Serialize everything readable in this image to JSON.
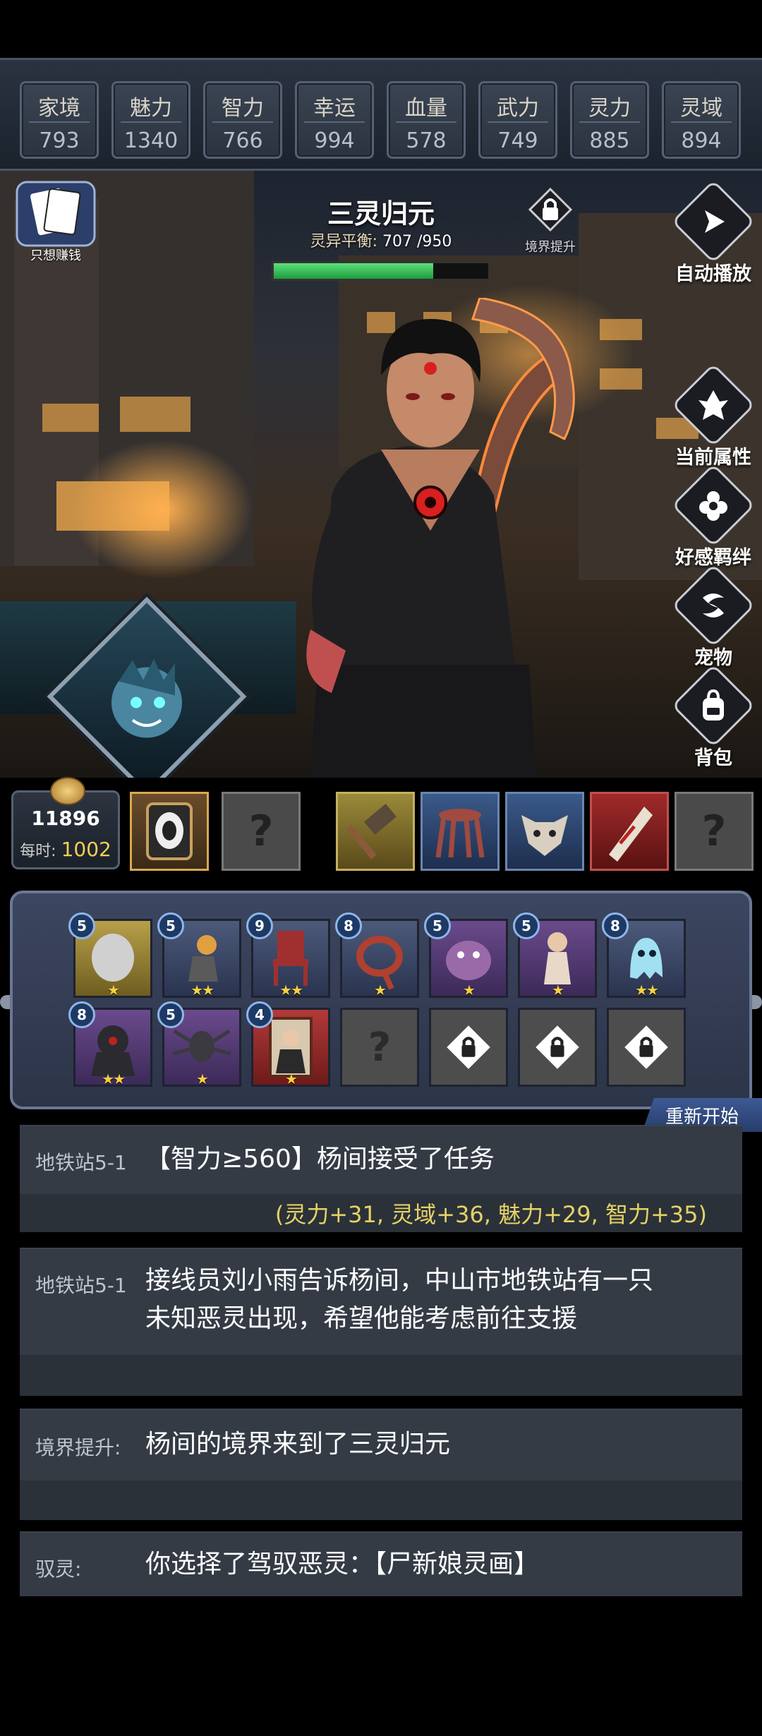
{
  "stats": [
    {
      "label": "家境",
      "value": "793"
    },
    {
      "label": "魅力",
      "value": "1340"
    },
    {
      "label": "智力",
      "value": "766"
    },
    {
      "label": "幸运",
      "value": "994"
    },
    {
      "label": "血量",
      "value": "578"
    },
    {
      "label": "武力",
      "value": "749"
    },
    {
      "label": "灵力",
      "value": "885"
    },
    {
      "label": "灵域",
      "value": "894"
    }
  ],
  "character": {
    "realm_name": "三灵归元",
    "balance_label": "灵异平衡:",
    "balance_current": "707",
    "balance_max": "/950",
    "balance_fraction": 0.744
  },
  "buttons": {
    "money": "只想赚钱",
    "realm_up": "境界提升",
    "autoplay": "自动播放",
    "attributes": "当前属性",
    "affinity": "好感羁绊",
    "pet": "宠物",
    "bag": "背包",
    "restart": "重新开始"
  },
  "coins": {
    "total": "11896",
    "rate_label": "每时:",
    "rate_value": "1002"
  },
  "collection": [
    {
      "level": "5",
      "stars": "★",
      "rarity": "gold"
    },
    {
      "level": "5",
      "stars": "★★",
      "rarity": "blue"
    },
    {
      "level": "9",
      "stars": "★★",
      "rarity": "blue"
    },
    {
      "level": "8",
      "stars": "★",
      "rarity": "blue"
    },
    {
      "level": "5",
      "stars": "★",
      "rarity": "purple"
    },
    {
      "level": "5",
      "stars": "★",
      "rarity": "purple"
    },
    {
      "level": "8",
      "stars": "★★",
      "rarity": "blue"
    },
    {
      "level": "8",
      "stars": "★★",
      "rarity": "purple"
    },
    {
      "level": "5",
      "stars": "★",
      "rarity": "purple"
    },
    {
      "level": "4",
      "stars": "★",
      "rarity": "red"
    }
  ],
  "logs": [
    {
      "tag": "地铁站5-1",
      "text": "【智力≥560】杨间接受了任务",
      "bonus": "(灵力+31, 灵域+36, 魅力+29, 智力+35)"
    },
    {
      "tag": "地铁站5-1",
      "line1": "接线员刘小雨告诉杨间，中山市地铁站有一只",
      "line2": "未知恶灵出现，希望他能考虑前往支援"
    },
    {
      "tag": "境界提升:",
      "text": "杨间的境界来到了三灵归元"
    },
    {
      "tag": "驭灵:",
      "text": "你选择了驾驭恶灵：【尸新娘灵画】"
    }
  ]
}
